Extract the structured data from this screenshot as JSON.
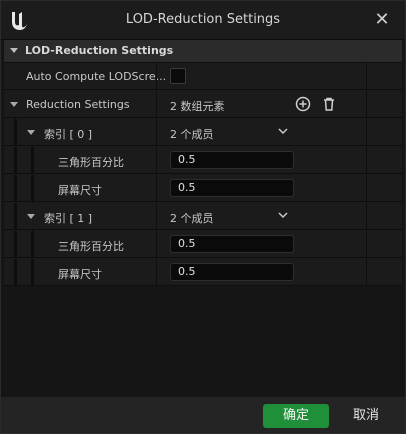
{
  "window": {
    "title": "LOD-Reduction Settings"
  },
  "category": {
    "label": "LOD-Reduction Settings"
  },
  "auto_compute": {
    "label": "Auto Compute LODScre..."
  },
  "reduction": {
    "label": "Reduction Settings",
    "count": "2 数组元素"
  },
  "elements": [
    {
      "label": "索引 [ 0 ]",
      "count": "2 个成员",
      "fields": [
        {
          "label": "三角形百分比",
          "value": "0.5"
        },
        {
          "label": "屏幕尺寸",
          "value": "0.5"
        }
      ]
    },
    {
      "label": "索引 [ 1 ]",
      "count": "2 个成员",
      "fields": [
        {
          "label": "三角形百分比",
          "value": "0.5"
        },
        {
          "label": "屏幕尺寸",
          "value": "0.5"
        }
      ]
    }
  ],
  "footer": {
    "ok_label": "确定",
    "cancel_label": "取消"
  },
  "colors": {
    "accent": "#1f8f3a",
    "background": "#151515",
    "panel": "#1b1b1b"
  },
  "icons": [
    "unreal-logo-icon",
    "close-icon",
    "add-circle-icon",
    "trash-icon",
    "chevron-down-icon"
  ]
}
